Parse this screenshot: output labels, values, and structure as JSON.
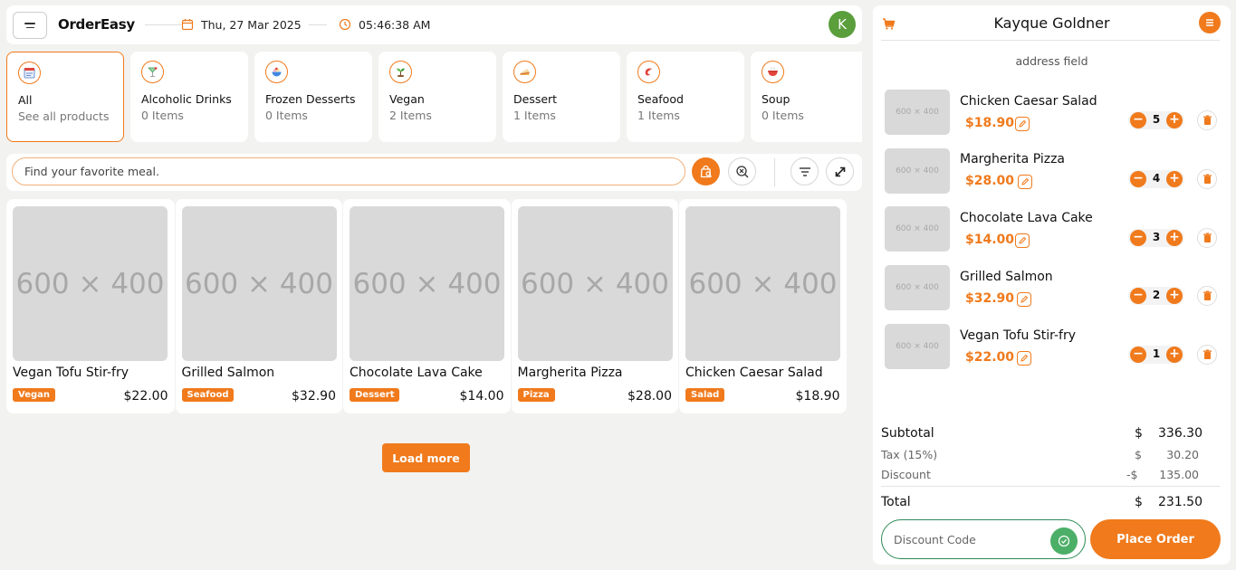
{
  "header": {
    "brand": "OrderEasy",
    "date": "Thu, 27 Mar 2025",
    "time": "05:46:38 AM",
    "avatar_initial": "K"
  },
  "categories": [
    {
      "name": "All",
      "count": "See all products",
      "icon": "menu-list-icon",
      "active": true
    },
    {
      "name": "Alcoholic Drinks",
      "count": "0 Items",
      "icon": "cocktail-icon"
    },
    {
      "name": "Frozen Desserts",
      "count": "0 Items",
      "icon": "ice-cream-icon"
    },
    {
      "name": "Vegan",
      "count": "2 Items",
      "icon": "sprout-icon"
    },
    {
      "name": "Dessert",
      "count": "1 Items",
      "icon": "cake-icon"
    },
    {
      "name": "Seafood",
      "count": "1 Items",
      "icon": "shrimp-icon"
    },
    {
      "name": "Soup",
      "count": "0 Items",
      "icon": "soup-bowl-icon"
    }
  ],
  "search": {
    "placeholder": "Find your favorite meal."
  },
  "products": [
    {
      "image": "600 × 400",
      "name": "Vegan Tofu Stir-fry",
      "tag": "Vegan",
      "price": "$22.00"
    },
    {
      "image": "600 × 400",
      "name": "Grilled Salmon",
      "tag": "Seafood",
      "price": "$32.90"
    },
    {
      "image": "600 × 400",
      "name": "Chocolate Lava Cake",
      "tag": "Dessert",
      "price": "$14.00"
    },
    {
      "image": "600 × 400",
      "name": "Margherita Pizza",
      "tag": "Pizza",
      "price": "$28.00"
    },
    {
      "image": "600 × 400",
      "name": "Chicken Caesar Salad",
      "tag": "Salad",
      "price": "$18.90"
    }
  ],
  "load_more": "Load more",
  "order": {
    "customer": "Kayque Goldner",
    "address": "address field",
    "items": [
      {
        "image": "600 × 400",
        "name": "Chicken Caesar Salad",
        "price": "$18.90",
        "qty": "5"
      },
      {
        "image": "600 × 400",
        "name": "Margherita Pizza",
        "price": "$28.00",
        "qty": "4"
      },
      {
        "image": "600 × 400",
        "name": "Chocolate Lava Cake",
        "price": "$14.00",
        "qty": "3"
      },
      {
        "image": "600 × 400",
        "name": "Grilled Salmon",
        "price": "$32.90",
        "qty": "2"
      },
      {
        "image": "600 × 400",
        "name": "Vegan Tofu Stir-fry",
        "price": "$22.00",
        "qty": "1"
      }
    ],
    "summary": {
      "subtotal_label": "Subtotal",
      "subtotal_cur": "$",
      "subtotal": "336.30",
      "tax_label": "Tax (15%)",
      "tax_cur": "$",
      "tax": "30.20",
      "discount_label": "Discount",
      "discount_cur": "-$",
      "discount": "135.00",
      "total_label": "Total",
      "total_cur": "$",
      "total": "231.50"
    },
    "discount_placeholder": "Discount Code",
    "place_order": "Place Order"
  },
  "colors": {
    "accent": "#f07a1c",
    "success": "#4caf68",
    "avatar": "#5b9e3c"
  }
}
